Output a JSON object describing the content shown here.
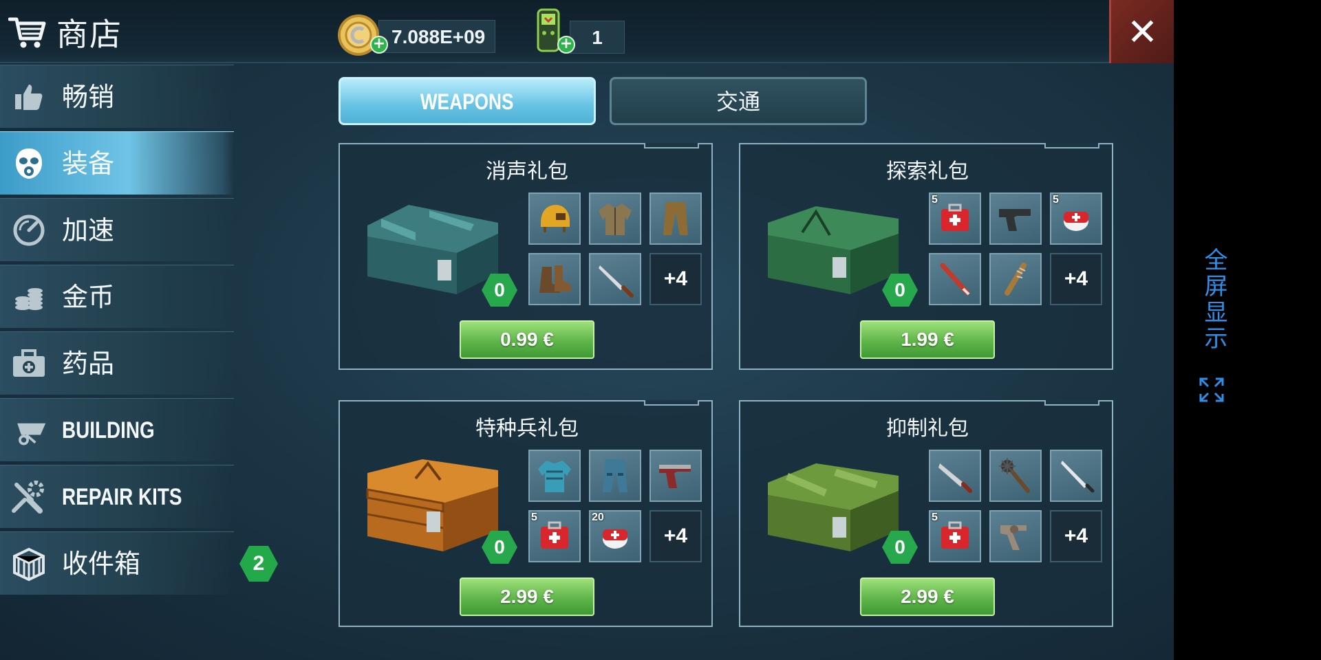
{
  "header": {
    "title": "商店",
    "icon": "cart-icon",
    "coins": "7.088E+09",
    "energy": "1",
    "close_label": "✕"
  },
  "sidebar": {
    "items": [
      {
        "label": "畅销",
        "icon": "thumbs-up-icon"
      },
      {
        "label": "装备",
        "icon": "gas-mask-icon",
        "active": true
      },
      {
        "label": "加速",
        "icon": "speedometer-icon"
      },
      {
        "label": "金币",
        "icon": "coins-icon"
      },
      {
        "label": "药品",
        "icon": "medkit-icon"
      },
      {
        "label": "BUILDING",
        "icon": "wheelbarrow-icon"
      },
      {
        "label": "REPAIR KITS",
        "icon": "tools-icon"
      },
      {
        "label": "收件箱",
        "icon": "crate-icon",
        "badge": "2"
      }
    ]
  },
  "tabs": [
    {
      "label": "WEAPONS",
      "active": true
    },
    {
      "label": "交通",
      "active": false
    }
  ],
  "packs": [
    {
      "title": "消声礼包",
      "owned": "0",
      "price": "0.99 €",
      "chest_color": "teal",
      "items": [
        {
          "icon": "helmet-icon",
          "count": ""
        },
        {
          "icon": "jacket-icon",
          "count": ""
        },
        {
          "icon": "pants-icon",
          "count": ""
        },
        {
          "icon": "boots-icon",
          "count": ""
        },
        {
          "icon": "knife-icon",
          "count": ""
        },
        {
          "icon": "more",
          "count": "+4"
        }
      ]
    },
    {
      "title": "探索礼包",
      "owned": "0",
      "price": "1.99 €",
      "chest_color": "green",
      "items": [
        {
          "icon": "medkit-icon",
          "count": "5"
        },
        {
          "icon": "pistol-icon",
          "count": ""
        },
        {
          "icon": "bandage-icon",
          "count": "5"
        },
        {
          "icon": "bat-icon",
          "count": ""
        },
        {
          "icon": "spiked-bat-icon",
          "count": ""
        },
        {
          "icon": "more",
          "count": "+4"
        }
      ]
    },
    {
      "title": "特种兵礼包",
      "owned": "0",
      "price": "2.99 €",
      "chest_color": "orange",
      "items": [
        {
          "icon": "armor-vest-icon",
          "count": ""
        },
        {
          "icon": "armor-pants-icon",
          "count": ""
        },
        {
          "icon": "pistol-icon",
          "count": ""
        },
        {
          "icon": "medkit-icon",
          "count": "5"
        },
        {
          "icon": "bandage-icon",
          "count": "20"
        },
        {
          "icon": "more",
          "count": "+4"
        }
      ]
    },
    {
      "title": "抑制礼包",
      "owned": "0",
      "price": "2.99 €",
      "chest_color": "olive",
      "items": [
        {
          "icon": "machete-icon",
          "count": ""
        },
        {
          "icon": "mace-icon",
          "count": ""
        },
        {
          "icon": "sword-icon",
          "count": ""
        },
        {
          "icon": "medkit-icon",
          "count": "5"
        },
        {
          "icon": "revolver-icon",
          "count": ""
        },
        {
          "icon": "more",
          "count": "+4"
        }
      ]
    }
  ],
  "fullscreen_label": "全屏显示",
  "colors": {
    "accent_blue": "#67c3e4",
    "price_green": "#5fb54a",
    "badge_green": "#27a84c",
    "close_red": "#7a2a22",
    "fullscreen_blue": "#2f8fe8"
  }
}
